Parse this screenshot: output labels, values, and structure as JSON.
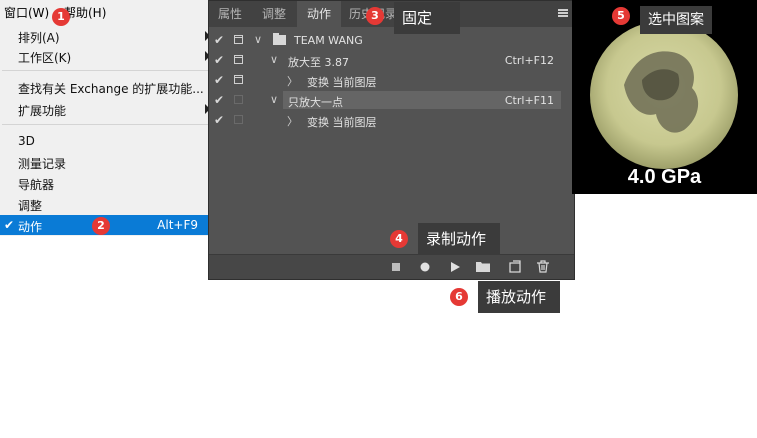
{
  "menubar": {
    "window_label": "窗口(W)",
    "help_label": "帮助(H)"
  },
  "menu": {
    "items": [
      {
        "label": "排列(A)",
        "submenu": true
      },
      {
        "label": "工作区(K)",
        "submenu": true
      },
      {
        "label": "查找有关 Exchange 的扩展功能..."
      },
      {
        "label": "扩展功能",
        "submenu": true
      },
      {
        "label": "3D"
      },
      {
        "label": "测量记录"
      },
      {
        "label": "导航器"
      },
      {
        "label": "调整"
      },
      {
        "label": "动作",
        "shortcut": "Alt+F9",
        "checked": true,
        "check_mark": "✔"
      }
    ]
  },
  "panel": {
    "tabs": [
      "属性",
      "调整",
      "动作",
      "历史记录"
    ],
    "active_tab": "动作",
    "rows": [
      {
        "check": "✔",
        "name": "TEAM WANG",
        "twisty": "∨"
      },
      {
        "check": "✔",
        "name": "放大至 3.87",
        "twisty": "∨",
        "shortcut": "Ctrl+F12"
      },
      {
        "check": "✔",
        "name": "变换 当前图层",
        "twisty": "〉"
      },
      {
        "check": "✔",
        "name": "只放大一点",
        "twisty": "∨",
        "shortcut": "Ctrl+F11"
      },
      {
        "check": "✔",
        "name": "变换 当前图层",
        "twisty": "〉"
      }
    ],
    "toolbar_icons": [
      "stop-icon",
      "record-icon",
      "play-icon",
      "folder-icon",
      "new-action-icon",
      "trash-icon"
    ]
  },
  "tooltips": {
    "pin": "固定",
    "record": "录制动作",
    "select_pattern": "选中图案",
    "play": "播放动作"
  },
  "badges": [
    "1",
    "2",
    "3",
    "4",
    "5",
    "6"
  ],
  "scope": {
    "label": "4.0 GPa"
  },
  "colors": {
    "selection": "#0a7bd6",
    "badge": "#e53935",
    "panel": "#535353"
  }
}
